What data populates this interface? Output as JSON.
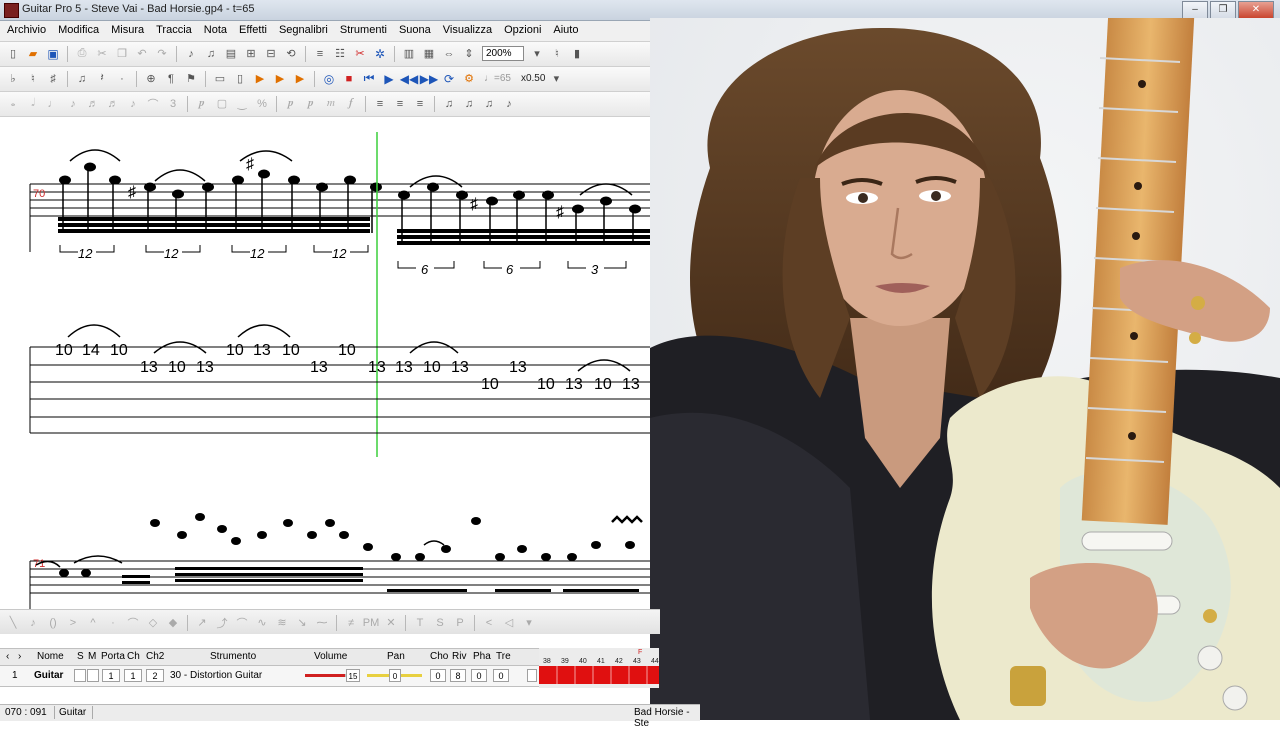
{
  "window": {
    "title": "Guitar Pro 5 - Steve Vai - Bad Horsie.gp4 - t=65",
    "buttons": [
      "–",
      "❐",
      "✕"
    ]
  },
  "menu": [
    "Archivio",
    "Modifica",
    "Misura",
    "Traccia",
    "Nota",
    "Effetti",
    "Segnalibri",
    "Strumenti",
    "Suona",
    "Visualizza",
    "Opzioni",
    "Aiuto"
  ],
  "toolbar": {
    "zoom": "200%",
    "tempo": "♩=65",
    "speed": "x0.50"
  },
  "score": {
    "bar_70": "70",
    "bar_71": "71",
    "tuplets_a": [
      "12",
      "12",
      "12",
      "12"
    ],
    "tuplets_b": [
      "6",
      "6",
      "3"
    ],
    "tab_frets": [
      "10",
      "14",
      "10",
      "13",
      "10",
      "13",
      "10",
      "13",
      "10",
      "13",
      "10",
      "13",
      "13",
      "10",
      "13",
      "10",
      "13",
      "10",
      "13",
      "10",
      "13",
      "10"
    ]
  },
  "tracks": {
    "headers": [
      "Nome",
      "S",
      "M",
      "Porta",
      "Ch",
      "Ch2",
      "Strumento",
      "Volume",
      "Pan",
      "Cho",
      "Riv",
      "Pha",
      "Tre"
    ],
    "rows": [
      {
        "index": "1",
        "name": "Guitar",
        "port": "1",
        "ch": "1",
        "ch2": "2",
        "instrument": "30 - Distortion Guitar",
        "volume": "15",
        "pan": "0",
        "cho": "0",
        "riv": "8",
        "pha": "0",
        "tre": "0"
      }
    ],
    "nav": [
      "‹",
      "›"
    ]
  },
  "timeline": {
    "bars": [
      "38",
      "39",
      "40",
      "41",
      "42",
      "43",
      "44"
    ],
    "marker": "F"
  },
  "status": {
    "position": "070 : 091",
    "track": "Guitar",
    "song": "Bad Horsie - Ste"
  },
  "colors": {
    "playhead": "#3ccf3c",
    "timeline_fill": "#e01010",
    "bar_number": "#d03030"
  }
}
